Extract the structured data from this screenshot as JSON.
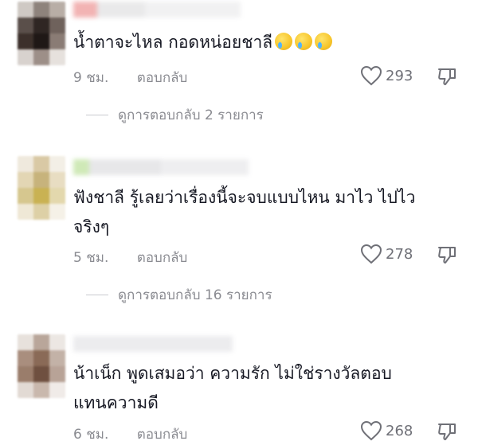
{
  "comments": [
    {
      "text": "น้ำตาจะไหล กอดหน่อยชาลี",
      "emoji_icons": [
        "crying-smile-emoji",
        "crying-smile-emoji",
        "crying-smile-emoji"
      ],
      "time": "9 ชม.",
      "reply_label": "ตอบกลับ",
      "likes": "293",
      "view_replies_label": "ดูการตอบกลับ 2 รายการ"
    },
    {
      "text_line1": "ฟังชาลี รู้เลยว่าเรื่องนี้จะจบแบบไหน มาไว ไปไว",
      "text_line2": "จริงๆ",
      "time": "5 ชม.",
      "reply_label": "ตอบกลับ",
      "likes": "278",
      "view_replies_label": "ดูการตอบกลับ 16 รายการ"
    },
    {
      "text_line1": "น้าเน็ก พูดเสมอว่า ความรัก ไม่ใช่รางวัลตอบ",
      "text_line2": "แทนความดี",
      "time": "6 ชม.",
      "reply_label": "ตอบกลับ",
      "likes": "268"
    }
  ],
  "icons": {
    "like": "heart-outline-icon",
    "dislike": "thumbs-down-outline-icon"
  },
  "colors": {
    "text": "#161823",
    "meta": "#8a8b91",
    "divider": "#c9cacf"
  }
}
